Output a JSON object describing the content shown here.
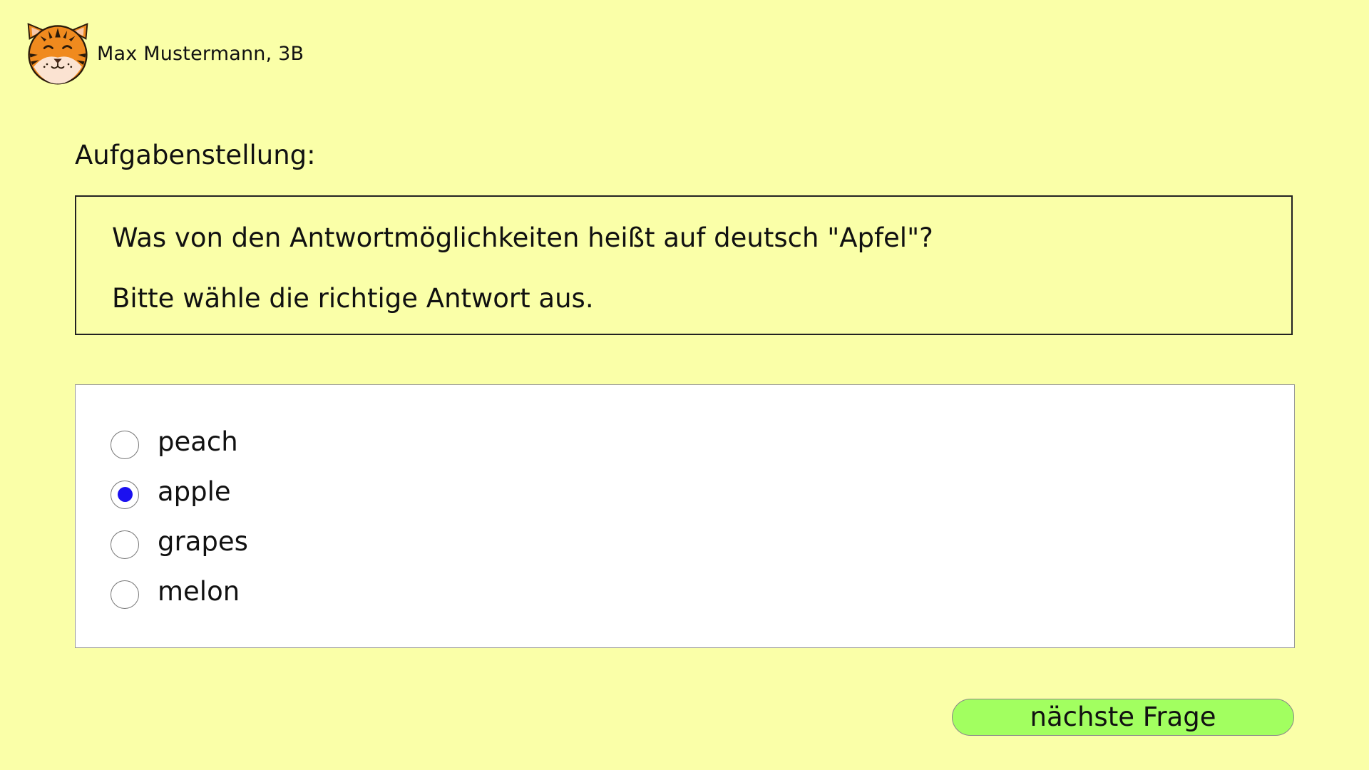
{
  "header": {
    "avatar_icon": "tiger-avatar-icon",
    "user_name": "Max Mustermann, 3B"
  },
  "task": {
    "heading": "Aufgabenstellung:",
    "question": "Was von den Antwortmöglichkeiten heißt auf deutsch \"Apfel\"?",
    "instruction": "Bitte wähle die richtige Antwort aus."
  },
  "answers": {
    "selected_index": 1,
    "options": [
      {
        "label": "peach",
        "selected": false
      },
      {
        "label": "apple",
        "selected": true
      },
      {
        "label": "grapes",
        "selected": false
      },
      {
        "label": "melon",
        "selected": false
      }
    ]
  },
  "footer": {
    "next_label": "nächste Frage"
  },
  "colors": {
    "background": "#faffa8",
    "answer_panel": "#ffffff",
    "radio_selected": "#1b10f0",
    "next_button": "#a2ff60"
  }
}
